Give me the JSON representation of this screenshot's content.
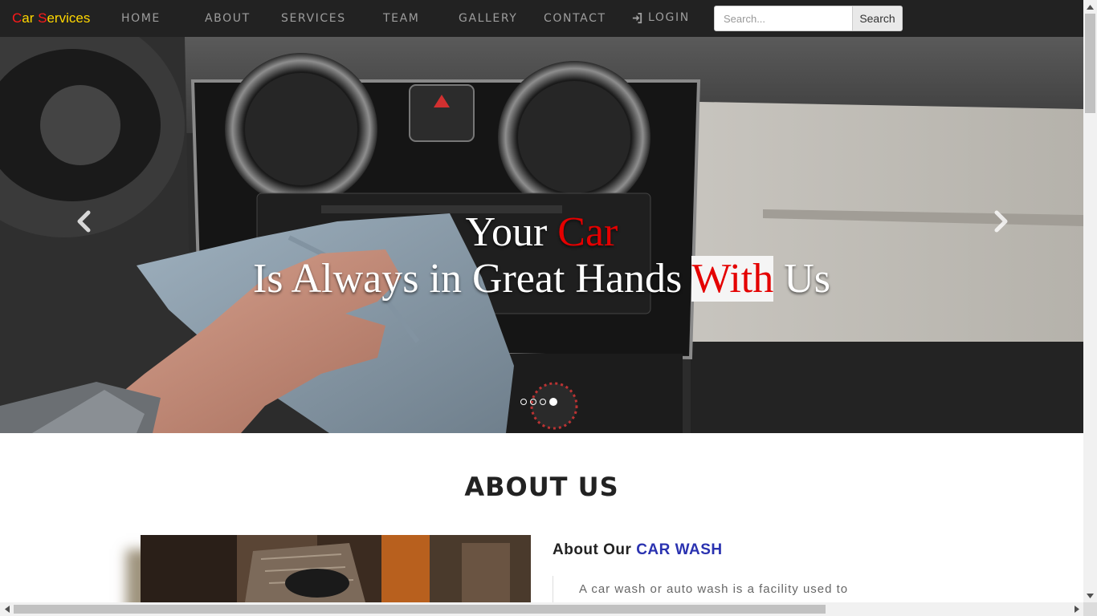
{
  "brand": {
    "c": "C",
    "ar": "ar ",
    "s": "S",
    "ervices": "ervices"
  },
  "nav": {
    "home": "HOME",
    "about": "ABOUT",
    "services": "SERVICES",
    "team": "TEAM",
    "gallery": "GALLERY",
    "contact": "CONTACT",
    "login": "LOGIN"
  },
  "search": {
    "placeholder": "Search...",
    "button": "Search"
  },
  "hero": {
    "line1_a": "Your ",
    "line1_b": "Car",
    "line2_a": "Is Always in Great Hands ",
    "line2_b": "With",
    "line2_c": " Us",
    "slide_count": 4,
    "active_slide": 4
  },
  "about": {
    "title": "ABOUT US",
    "sub_a": "About Our ",
    "sub_b": "CAR WASH",
    "text": "A car wash or auto wash is a facility used to"
  },
  "colors": {
    "navbar": "#222222",
    "brand_red": "#ff1a1a",
    "brand_yellow": "#ffd700",
    "accent_red": "#e40000",
    "accent_blue": "#2a32b0"
  },
  "icons": [
    "login-icon",
    "chevron-left-icon",
    "chevron-right-icon"
  ]
}
